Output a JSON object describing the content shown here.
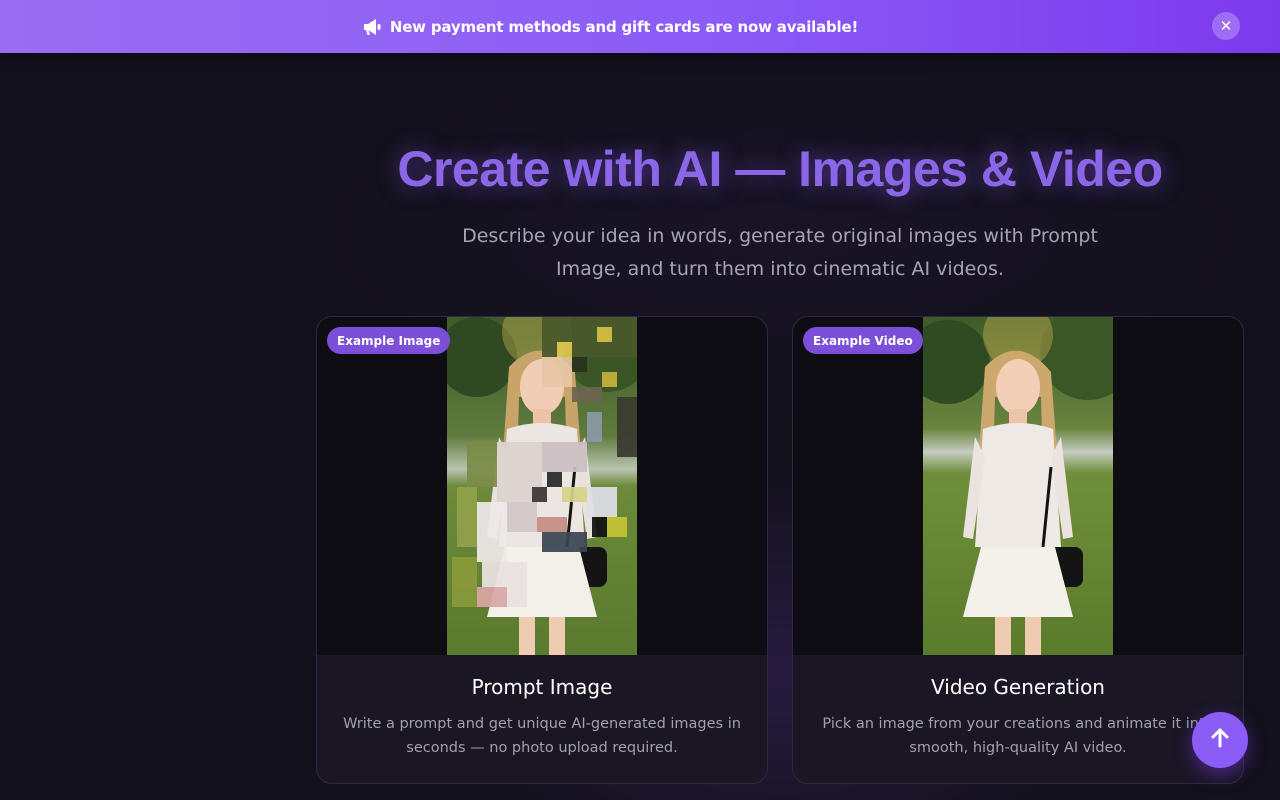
{
  "banner": {
    "icon": "megaphone-icon",
    "text": "New payment methods and gift cards are now available!",
    "close_icon": "close-icon",
    "close_label": "✕"
  },
  "hero": {
    "title": "Create with AI — Images & Video",
    "subtitle": "Describe your idea in words, generate original images with Prompt Image, and turn them into cinematic AI videos."
  },
  "cards": [
    {
      "badge": "Example Image",
      "title": "Prompt Image",
      "description": "Write a prompt and get unique AI-generated images in seconds — no photo upload required."
    },
    {
      "badge": "Example Video",
      "title": "Video Generation",
      "description": "Pick an image from your creations and animate it into smooth, high-quality AI video."
    }
  ],
  "scroll_top": {
    "icon": "arrow-up-icon"
  },
  "colors": {
    "accent": "#8b5cf6",
    "background": "#13111c",
    "card": "#1a1624",
    "title": "#8b67e8"
  }
}
